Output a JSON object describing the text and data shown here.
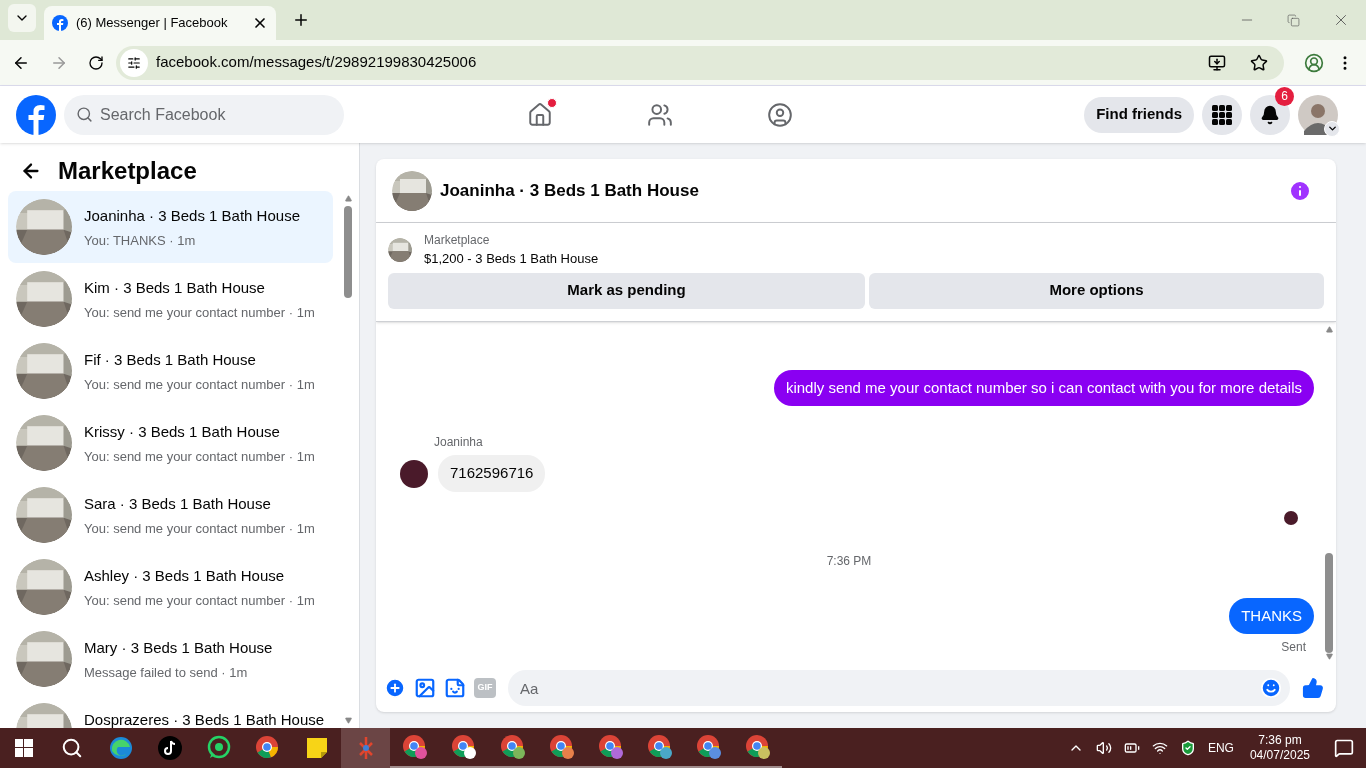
{
  "browser": {
    "tab": {
      "title": "(6) Messenger | Facebook",
      "selected": true
    },
    "url": "facebook.com/messages/t/29892199830425006"
  },
  "header": {
    "search": {
      "placeholder": "Search Facebook"
    },
    "nav": [
      {
        "kind": "home",
        "dot": true
      },
      {
        "kind": "friends",
        "dot": false
      },
      {
        "kind": "groups",
        "dot": false
      }
    ],
    "find_friends": "Find friends",
    "notifications": "6"
  },
  "sidebar": {
    "title": "Marketplace",
    "conversations": [
      {
        "title": "Joaninha · 3 Beds 1 Bath House",
        "preview": "You: THANKS · 1m",
        "selected": true
      },
      {
        "title": "Kim · 3 Beds 1 Bath House",
        "preview": "You: send me your contact number · 1m",
        "selected": false
      },
      {
        "title": "Fif · 3 Beds 1 Bath House",
        "preview": "You: send me your contact number · 1m",
        "selected": false
      },
      {
        "title": "Krissy · 3 Beds 1 Bath House",
        "preview": "You: send me your contact number · 1m",
        "selected": false
      },
      {
        "title": "Sara · 3 Beds 1 Bath House",
        "preview": "You: send me your contact number · 1m",
        "selected": false
      },
      {
        "title": "Ashley · 3 Beds 1 Bath House",
        "preview": "You: send me your contact number · 1m",
        "selected": false
      },
      {
        "title": "Mary · 3 Beds 1 Bath House",
        "preview": "Message failed to send · 1m",
        "selected": false
      },
      {
        "title": "Dosprazeres · 3 Beds 1 Bath House",
        "selected": false
      }
    ]
  },
  "chat": {
    "title": "Joaninha · 3 Beds 1 Bath House",
    "listing": {
      "label": "Marketplace",
      "text": "$1,200 - 3 Beds 1 Bath House"
    },
    "actions": [
      "Mark as pending",
      "More options"
    ],
    "messages": [
      {
        "kind": "sent",
        "text": "kindly send me your contact number so i can contact with you for more details",
        "color": "#8a00f2"
      },
      {
        "kind": "received",
        "sender": "Joaninha",
        "text": "7162596716"
      },
      {
        "kind": "seen"
      },
      {
        "kind": "timestamp",
        "text": "7:36 PM"
      },
      {
        "kind": "sent",
        "text": "THANKS",
        "color": "#0866ff",
        "status": "Sent"
      }
    ],
    "composer": {
      "gif": "GIF",
      "placeholder": "Aa"
    }
  },
  "taskbar": {
    "apps": [
      {
        "kind": "edge"
      },
      {
        "kind": "tiktok"
      },
      {
        "kind": "whatsapp"
      },
      {
        "kind": "chrome"
      },
      {
        "kind": "notes"
      },
      {
        "kind": "tool",
        "selected": true
      },
      {
        "kind": "profile",
        "color": "#e0529c"
      },
      {
        "kind": "profile",
        "color": "#ffffff"
      },
      {
        "kind": "profile",
        "color": "#7cb65a"
      },
      {
        "kind": "profile",
        "color": "#e8804a"
      },
      {
        "kind": "profile",
        "color": "#b06ad8"
      },
      {
        "kind": "profile",
        "color": "#4aa8c8"
      },
      {
        "kind": "profile",
        "color": "#5b8ee0"
      },
      {
        "kind": "profile",
        "color": "#c8c060"
      }
    ],
    "language": "ENG",
    "time": "7:36 pm",
    "date": "04/07/2025"
  }
}
